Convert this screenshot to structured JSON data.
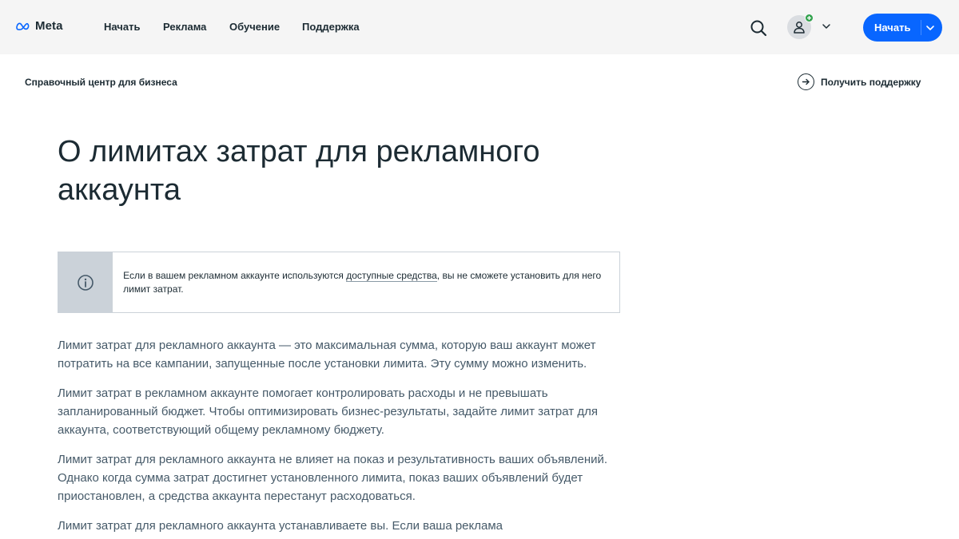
{
  "topnav": {
    "logo_text": "Meta",
    "links": [
      "Начать",
      "Реклама",
      "Обучение",
      "Поддержка"
    ],
    "cta_label": "Начать",
    "icons": {
      "search": "search-icon",
      "avatar": "user-icon",
      "badge": "plus-icon",
      "dropdown": "chevron-down-icon"
    }
  },
  "subheader": {
    "breadcrumb": "Справочный центр для бизнеса",
    "support_label": "Получить поддержку",
    "support_icon": "arrow-right-circle-icon"
  },
  "article": {
    "title": "О лимитах затрат для рекламного аккаунта",
    "notice": {
      "icon": "info-icon",
      "text_before": "Если в вашем рекламном аккаунте используются ",
      "link_text": "доступные средства",
      "text_after": ", вы не сможете установить для него лимит затрат."
    },
    "paragraphs": [
      "Лимит затрат для рекламного аккаунта — это максимальная сумма, которую ваш аккаунт может потратить на все кампании, запущенные после установки лимита. Эту сумму можно изменить.",
      "Лимит затрат в рекламном аккаунте помогает контролировать расходы и не превышать запланированный бюджет. Чтобы оптимизировать бизнес-результаты, задайте лимит затрат для аккаунта, соответствующий общему рекламному бюджету.",
      "Лимит затрат для рекламного аккаунта не влияет на показ и результативность ваших объявлений. Однако когда сумма затрат достигнет установленного лимита, показ ваших объявлений будет приостановлен, а средства аккаунта перестанут расходоваться.",
      "Лимит затрат для рекламного аккаунта устанавливаете вы. Если ваша реклама"
    ]
  },
  "colors": {
    "brand_blue": "#0866ff",
    "nav_bg": "#f5f5f5",
    "text_dark": "#1c2b33",
    "text_body": "#465a69",
    "notice_side": "#cbd2d9",
    "badge_green": "#31a24c"
  }
}
